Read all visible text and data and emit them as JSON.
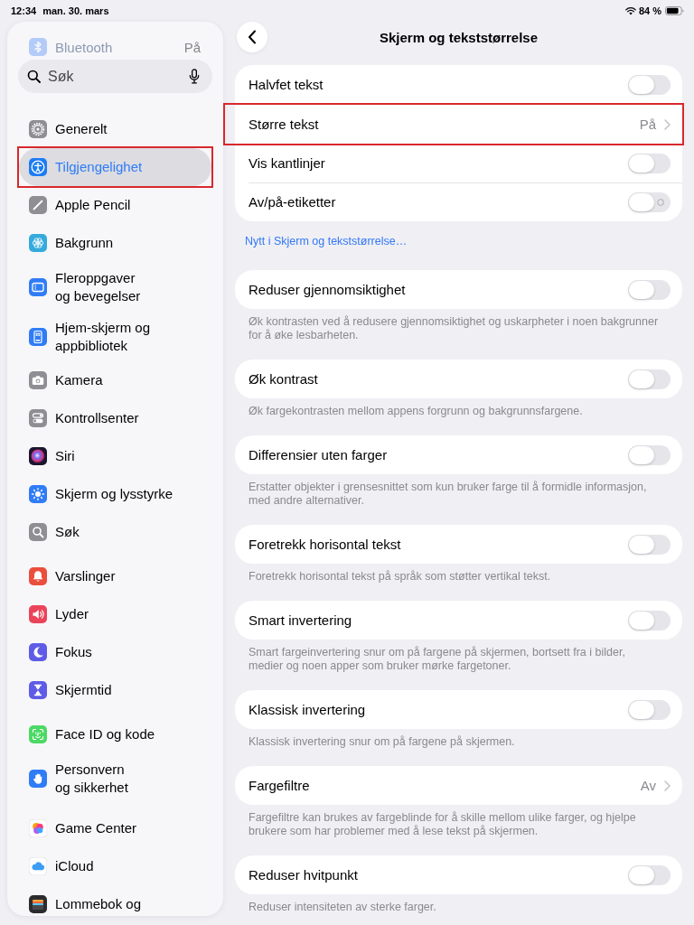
{
  "status_bar": {
    "time": "12:34",
    "date": "man. 30. mars",
    "battery": "84 %"
  },
  "sidebar": {
    "faded_item": {
      "kind": "bluetooth",
      "label": "Bluetooth",
      "value": "På"
    },
    "search": {
      "placeholder": "Søk"
    },
    "groups": [
      {
        "items": [
          {
            "kind": "general",
            "label": "Generelt",
            "selected": false,
            "marked": false
          },
          {
            "kind": "accessibility",
            "label": "Tilgjengelighet",
            "selected": true,
            "marked": true
          },
          {
            "kind": "pencil",
            "label": "Apple Pencil",
            "selected": false,
            "marked": false
          },
          {
            "kind": "wallpaper",
            "label": "Bakgrunn",
            "selected": false,
            "marked": false
          },
          {
            "kind": "multitasking",
            "label": "Fleroppgaver\nog bevegelser",
            "selected": false,
            "marked": false
          },
          {
            "kind": "homescreen",
            "label": "Hjem-skjerm og\nappbibliotek",
            "selected": false,
            "marked": false
          },
          {
            "kind": "camera",
            "label": "Kamera",
            "selected": false,
            "marked": false
          },
          {
            "kind": "controlcenter",
            "label": "Kontrollsenter",
            "selected": false,
            "marked": false
          },
          {
            "kind": "siri",
            "label": "Siri",
            "selected": false,
            "marked": false
          },
          {
            "kind": "display",
            "label": "Skjerm og lysstyrke",
            "selected": false,
            "marked": false
          },
          {
            "kind": "search",
            "label": "Søk",
            "selected": false,
            "marked": false
          }
        ]
      },
      {
        "items": [
          {
            "kind": "notifications",
            "label": "Varslinger",
            "selected": false,
            "marked": false
          },
          {
            "kind": "sounds",
            "label": "Lyder",
            "selected": false,
            "marked": false
          },
          {
            "kind": "focus",
            "label": "Fokus",
            "selected": false,
            "marked": false
          },
          {
            "kind": "screentime",
            "label": "Skjermtid",
            "selected": false,
            "marked": false
          }
        ]
      },
      {
        "items": [
          {
            "kind": "faceid",
            "label": "Face ID og kode",
            "selected": false,
            "marked": false
          },
          {
            "kind": "privacy",
            "label": "Personvern\nog sikkerhet",
            "selected": false,
            "marked": false
          }
        ]
      },
      {
        "items": [
          {
            "kind": "gamecenter",
            "label": "Game Center",
            "selected": false,
            "marked": false
          },
          {
            "kind": "icloud",
            "label": "iCloud",
            "selected": false,
            "marked": false
          },
          {
            "kind": "wallet",
            "label": "Lommebok og",
            "selected": false,
            "marked": false
          }
        ]
      }
    ]
  },
  "page": {
    "title": "Skjerm og tekststørrelse",
    "sections": [
      {
        "rows": [
          {
            "kind": "toggle",
            "label": "Halvfet tekst",
            "on": false,
            "labels": false,
            "marked": false
          },
          {
            "kind": "link",
            "label": "Større tekst",
            "value": "På",
            "marked": true
          },
          {
            "kind": "toggle",
            "label": "Vis kantlinjer",
            "on": false,
            "labels": false,
            "marked": false
          },
          {
            "kind": "toggle",
            "label": "Av/på-etiketter",
            "on": false,
            "labels": true,
            "marked": false
          }
        ],
        "link": "Nytt i Skjerm og tekststørrelse…"
      },
      {
        "rows": [
          {
            "kind": "toggle",
            "label": "Reduser gjennomsiktighet",
            "on": false,
            "labels": false,
            "marked": false
          }
        ],
        "footer": "Øk kontrasten ved å redusere gjennomsiktighet og uskarpheter i noen bakgrunner\nfor å øke lesbarheten."
      },
      {
        "rows": [
          {
            "kind": "toggle",
            "label": "Øk kontrast",
            "on": false,
            "labels": false,
            "marked": false
          }
        ],
        "footer": "Øk fargekontrasten mellom appens forgrunn og bakgrunnsfargene."
      },
      {
        "rows": [
          {
            "kind": "toggle",
            "label": "Differensier uten farger",
            "on": false,
            "labels": false,
            "marked": false
          }
        ],
        "footer": "Erstatter objekter i grensesnittet som kun bruker farge til å formidle informasjon,\nmed andre alternativer."
      },
      {
        "rows": [
          {
            "kind": "toggle",
            "label": "Foretrekk horisontal tekst",
            "on": false,
            "labels": false,
            "marked": false
          }
        ],
        "footer": "Foretrekk horisontal tekst på språk som støtter vertikal tekst."
      },
      {
        "rows": [
          {
            "kind": "toggle",
            "label": "Smart invertering",
            "on": false,
            "labels": false,
            "marked": false
          }
        ],
        "footer": "Smart fargeinvertering snur om på fargene på skjermen, bortsett fra i bilder,\nmedier og noen apper som bruker mørke fargetoner."
      },
      {
        "rows": [
          {
            "kind": "toggle",
            "label": "Klassisk invertering",
            "on": false,
            "labels": false,
            "marked": false
          }
        ],
        "footer": "Klassisk invertering snur om på fargene på skjermen."
      },
      {
        "rows": [
          {
            "kind": "link",
            "label": "Fargefiltre",
            "value": "Av",
            "marked": false
          }
        ],
        "footer": "Fargefiltre kan brukes av fargeblinde for å skille mellom ulike farger, og hjelpe\nbrukere som har problemer med å lese tekst på skjermen."
      },
      {
        "rows": [
          {
            "kind": "toggle",
            "label": "Reduser hvitpunkt",
            "on": false,
            "labels": false,
            "marked": false
          }
        ],
        "footer": "Reduser intensiteten av sterke farger."
      }
    ]
  }
}
